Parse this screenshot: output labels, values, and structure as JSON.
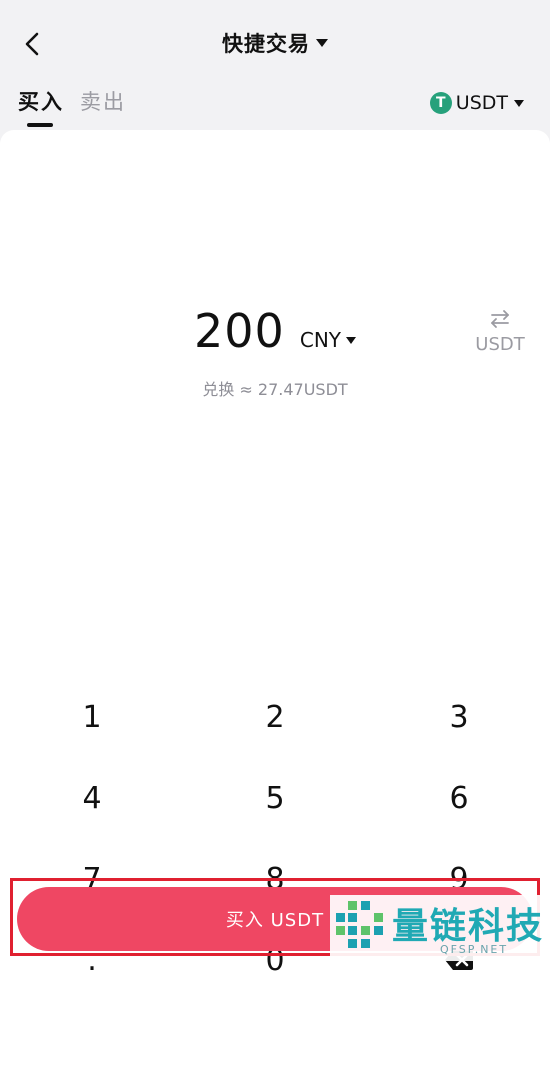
{
  "header": {
    "title": "快捷交易",
    "back_icon": "chevron-left-icon",
    "title_dropdown_icon": "caret-down-icon"
  },
  "tabs": [
    {
      "label": "买入",
      "active": true
    },
    {
      "label": "卖出",
      "active": false
    }
  ],
  "coin_selector": {
    "symbol": "USDT",
    "badge_glyph": "T",
    "icon": "tether-icon",
    "badge_color": "#26a17b"
  },
  "amount": {
    "value": "200",
    "currency": "CNY",
    "conversion_text": "兑换 ≈ 27.47USDT"
  },
  "swap": {
    "label": "USDT",
    "icon": "swap-arrows-icon"
  },
  "keypad": {
    "keys": [
      "1",
      "2",
      "3",
      "4",
      "5",
      "6",
      "7",
      "8",
      "9",
      ".",
      "0"
    ],
    "delete_icon": "backspace-icon"
  },
  "action": {
    "buy_label": "买入 USDT",
    "button_color": "#ef4763",
    "highlight_color": "#e02030"
  },
  "watermark": {
    "name": "量链科技",
    "url": "QFSP.NET",
    "color": "#20a9b4"
  }
}
